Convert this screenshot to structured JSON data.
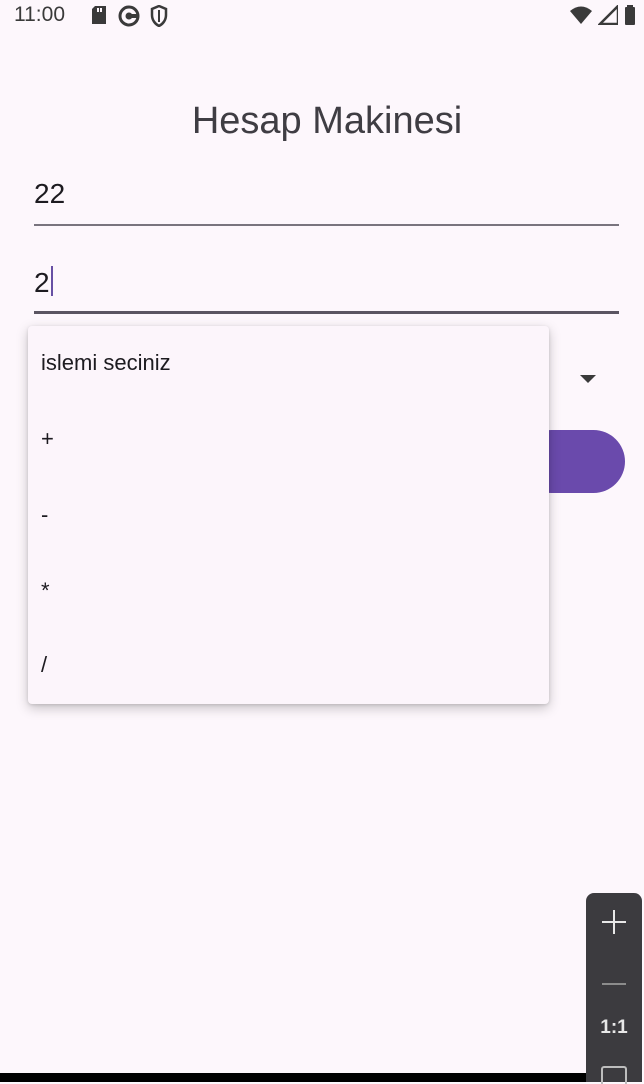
{
  "status_bar": {
    "time": "11:00"
  },
  "app": {
    "title": "Hesap Makinesi"
  },
  "inputs": {
    "first_number": "22",
    "second_number": "2"
  },
  "operation_menu": {
    "items": [
      "islemi seciniz",
      "+",
      "-",
      "*",
      "/"
    ]
  },
  "zoom_controls": {
    "ratio_label": "1:1"
  },
  "colors": {
    "accent": "#6a4aac",
    "background": "#fdf7fc",
    "menu_surface": "#fcf5fb"
  }
}
